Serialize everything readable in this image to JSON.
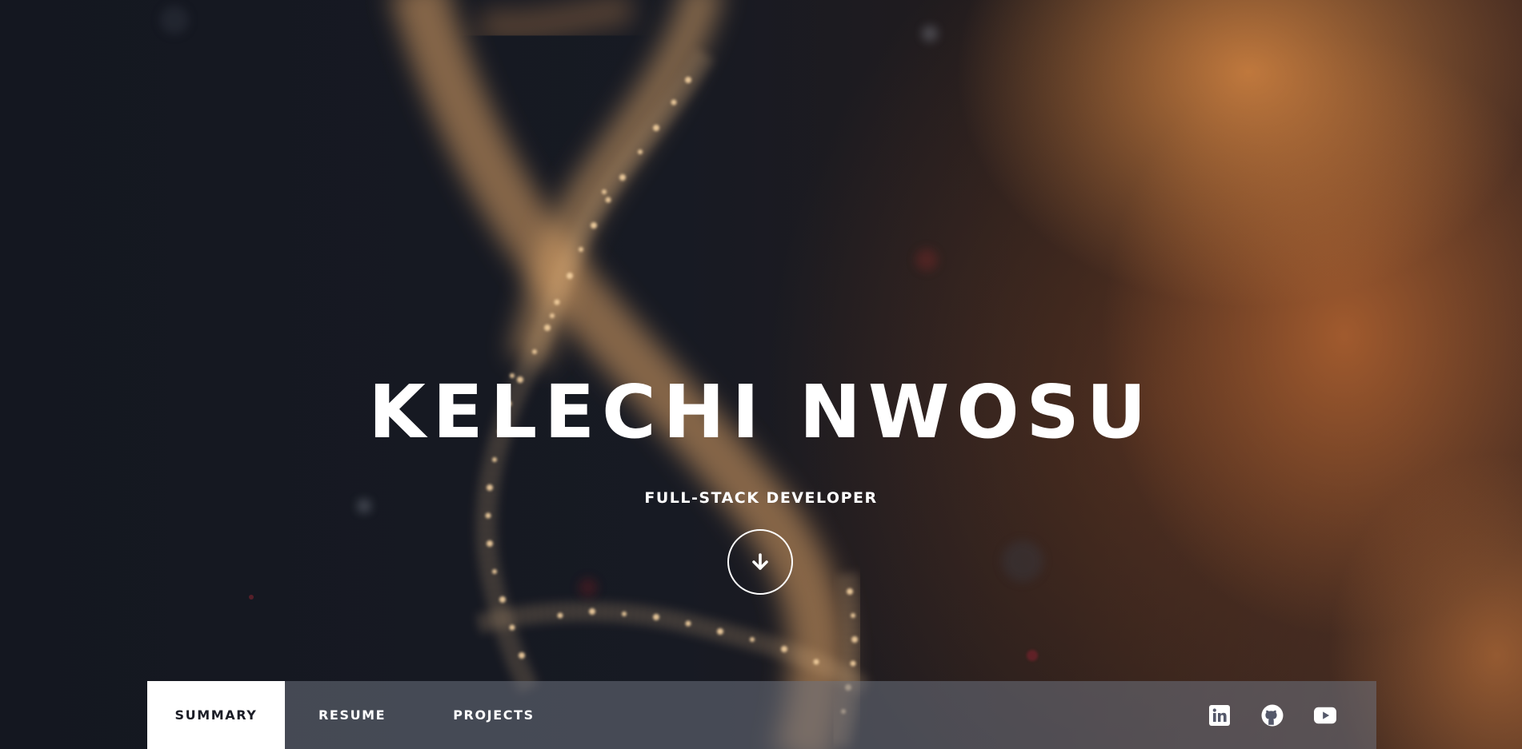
{
  "hero": {
    "name": "KELECHI NWOSU",
    "subtitle": "FULL-STACK DEVELOPER",
    "scroll_icon": "arrow-down-icon"
  },
  "nav": {
    "items": [
      {
        "label": "SUMMARY",
        "active": true
      },
      {
        "label": "RESUME",
        "active": false
      },
      {
        "label": "PROJECTS",
        "active": false
      }
    ],
    "social": [
      {
        "icon": "linkedin-icon"
      },
      {
        "icon": "github-icon"
      },
      {
        "icon": "youtube-icon"
      }
    ]
  },
  "colors": {
    "background_dark": "#15171f",
    "accent_glow": "#d68642",
    "nav_bar": "#6e7280",
    "active_tab_bg": "#ffffff",
    "active_tab_text": "#1b1d26"
  }
}
